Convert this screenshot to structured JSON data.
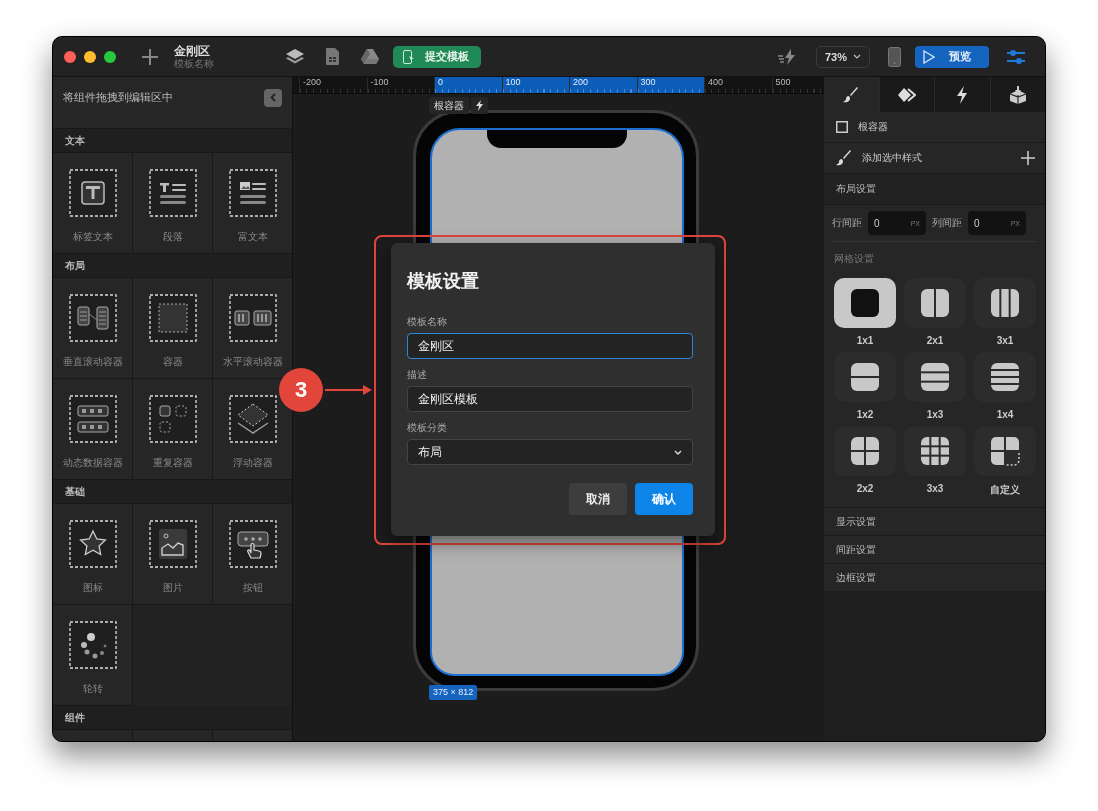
{
  "window": {
    "title": "金刚区",
    "subtitle": "模板名称"
  },
  "toolbar": {
    "submit_button": "提交模板",
    "zoom": "73%",
    "preview_button": "预览"
  },
  "ruler": {
    "ticks": [
      {
        "label": "-200",
        "highlighted": false
      },
      {
        "label": "-100",
        "highlighted": false
      },
      {
        "label": "0",
        "highlighted": true
      },
      {
        "label": "100",
        "highlighted": true
      },
      {
        "label": "200",
        "highlighted": true
      },
      {
        "label": "300",
        "highlighted": true
      },
      {
        "label": "400",
        "highlighted": false
      },
      {
        "label": "500",
        "highlighted": false
      }
    ]
  },
  "left_panel": {
    "header": "将组件拖拽到编辑区中",
    "sections": [
      {
        "title": "文本",
        "items": [
          {
            "label": "标签文本",
            "kind": "label"
          },
          {
            "label": "段落",
            "kind": "paragraph"
          },
          {
            "label": "富文本",
            "kind": "richtext"
          }
        ]
      },
      {
        "title": "布局",
        "items": [
          {
            "label": "垂直滚动容器",
            "kind": "vscroll"
          },
          {
            "label": "容器",
            "kind": "container"
          },
          {
            "label": "水平滚动容器",
            "kind": "hscroll"
          },
          {
            "label": "动态数据容器",
            "kind": "dynamic"
          },
          {
            "label": "重复容器",
            "kind": "repeat"
          },
          {
            "label": "浮动容器",
            "kind": "floating"
          }
        ]
      },
      {
        "title": "基础",
        "items": [
          {
            "label": "图标",
            "kind": "icon"
          },
          {
            "label": "图片",
            "kind": "image"
          },
          {
            "label": "按钮",
            "kind": "button"
          },
          {
            "label": "轮转",
            "kind": "carousel"
          }
        ]
      },
      {
        "title": "组件"
      }
    ]
  },
  "canvas": {
    "selection_label": "根容器",
    "size_badge": "375 × 812"
  },
  "callout": {
    "number": "3"
  },
  "dialog": {
    "title": "模板设置",
    "fields": [
      {
        "label": "模板名称",
        "value": "金刚区",
        "kind": "input",
        "focused": true
      },
      {
        "label": "描述",
        "value": "金刚区模板",
        "kind": "input",
        "focused": false
      },
      {
        "label": "模板分类",
        "value": "布局",
        "kind": "select",
        "focused": false
      }
    ],
    "buttons": [
      {
        "label": "取消",
        "kind": "secondary"
      },
      {
        "label": "确认",
        "kind": "primary"
      }
    ]
  },
  "right_panel": {
    "tabs": [
      {
        "kind": "brush",
        "selected": true
      },
      {
        "kind": "diamond",
        "selected": false
      },
      {
        "kind": "bolt",
        "selected": false
      },
      {
        "kind": "cube",
        "selected": false
      }
    ],
    "element": "根容器",
    "add_style": "添加选中样式",
    "layout_section": "布局设置",
    "gaps": [
      {
        "label": "行间距",
        "value": "0",
        "unit": "PX"
      },
      {
        "label": "列间距",
        "value": "0",
        "unit": "PX"
      }
    ],
    "grid_label": "网格设置",
    "grid_options": [
      {
        "label": "1x1",
        "kind": "single",
        "selected": true
      },
      {
        "label": "2x1",
        "kind": "twocols",
        "selected": false
      },
      {
        "label": "3x1",
        "kind": "threecols",
        "selected": false
      },
      {
        "label": "1x2",
        "kind": "tworows",
        "selected": false
      },
      {
        "label": "1x3",
        "kind": "threerows",
        "selected": false
      },
      {
        "label": "1x4",
        "kind": "fourrows",
        "selected": false
      },
      {
        "label": "2x2",
        "kind": "quad",
        "selected": false
      },
      {
        "label": "3x3",
        "kind": "nine",
        "selected": false
      },
      {
        "label": "自定义",
        "kind": "custom",
        "selected": false
      }
    ],
    "sections": [
      "显示设置",
      "间距设置",
      "边框设置"
    ]
  }
}
